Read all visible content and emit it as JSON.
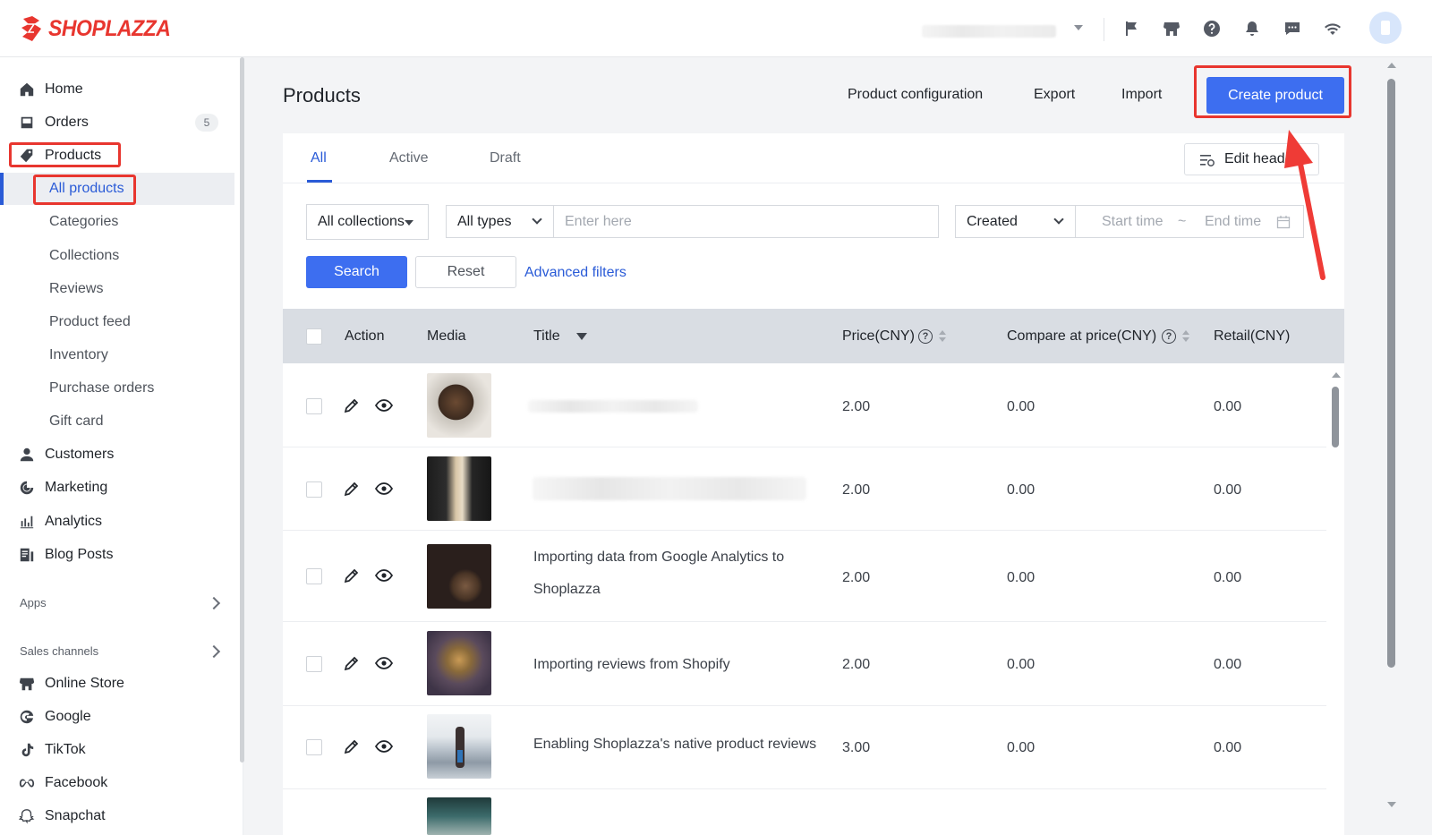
{
  "brand": {
    "name": "SHOPLAZZA",
    "color": "#e8362f"
  },
  "topbar": {
    "icons": [
      "flag-icon",
      "store-icon",
      "help-icon",
      "bell-icon",
      "chat-icon",
      "wifi-icon"
    ]
  },
  "sidebar": {
    "items": [
      {
        "label": "Home",
        "icon": "home-icon"
      },
      {
        "label": "Orders",
        "icon": "orders-icon",
        "badge": "5"
      },
      {
        "label": "Products",
        "icon": "tag-icon"
      },
      {
        "label": "Customers",
        "icon": "user-icon"
      },
      {
        "label": "Marketing",
        "icon": "marketing-icon"
      },
      {
        "label": "Analytics",
        "icon": "analytics-icon"
      },
      {
        "label": "Blog Posts",
        "icon": "blog-icon"
      }
    ],
    "product_sub": [
      "All products",
      "Categories",
      "Collections",
      "Reviews",
      "Product feed",
      "Inventory",
      "Purchase orders",
      "Gift card"
    ],
    "apps_label": "Apps",
    "sales_channels_label": "Sales channels",
    "channels": [
      {
        "label": "Online Store",
        "icon": "store-icon"
      },
      {
        "label": "Google",
        "icon": "google-icon"
      },
      {
        "label": "TikTok",
        "icon": "tiktok-icon"
      },
      {
        "label": "Facebook",
        "icon": "meta-icon"
      },
      {
        "label": "Snapchat",
        "icon": "snapchat-icon"
      }
    ]
  },
  "header": {
    "title": "Products",
    "product_configuration": "Product configuration",
    "export": "Export",
    "import": "Import",
    "create_product": "Create product"
  },
  "tabs": [
    "All",
    "Active",
    "Draft"
  ],
  "edit_header": "Edit header",
  "filters": {
    "collections": "All collections",
    "types": "All types",
    "search_placeholder": "Enter here",
    "date_field": "Created",
    "start_placeholder": "Start time",
    "tilde": "~",
    "end_placeholder": "End time",
    "search_button": "Search",
    "reset_button": "Reset",
    "advanced_filters": "Advanced filters"
  },
  "table": {
    "columns": [
      "Action",
      "Media",
      "Title",
      "Price(CNY)",
      "Compare at price(CNY)",
      "Retail(CNY)"
    ],
    "help_mark": "?",
    "rows": [
      {
        "title": "",
        "price": "2.00",
        "compare": "0.00",
        "retail": "0.00"
      },
      {
        "title": "",
        "price": "2.00",
        "compare": "0.00",
        "retail": "0.00"
      },
      {
        "title_line1": "Importing data from Google Analytics to",
        "title_line2": "Shoplazza",
        "price": "2.00",
        "compare": "0.00",
        "retail": "0.00"
      },
      {
        "title": "Importing reviews from Shopify",
        "price": "2.00",
        "compare": "0.00",
        "retail": "0.00"
      },
      {
        "title": "Enabling Shoplazza's native product reviews",
        "price": "3.00",
        "compare": "0.00",
        "retail": "0.00"
      }
    ]
  },
  "colors": {
    "primary": "#3d6ef0",
    "highlight": "#e8362f",
    "link": "#2a5bd7"
  }
}
